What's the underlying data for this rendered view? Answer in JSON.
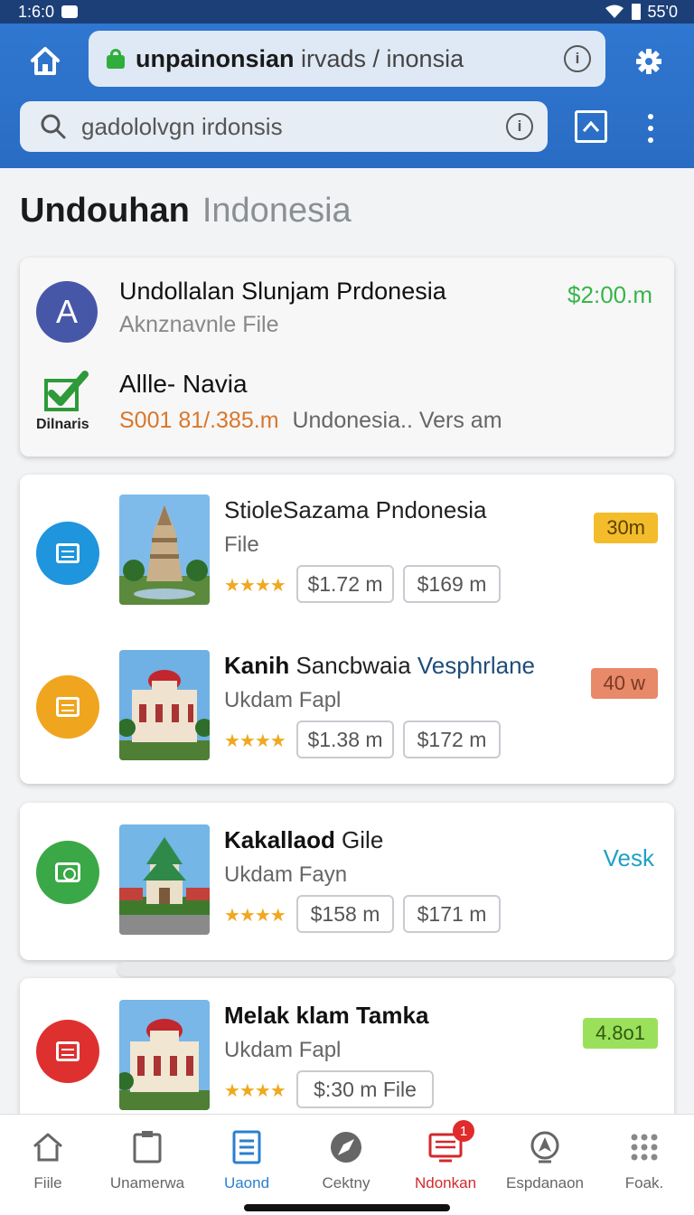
{
  "status_bar": {
    "time": "1:6:0",
    "battery": "55'0"
  },
  "header": {
    "url": {
      "bold": "unpainonsian",
      "rest": " irvads  / inonsia"
    },
    "search": {
      "text": "gadololvgn irdonsis"
    }
  },
  "page_title": {
    "primary": "Undouhan",
    "secondary": "Indonesia"
  },
  "summary": {
    "avatar_letter": "A",
    "title": "Undollalan Slunjam Prdonesia",
    "subtitle": "Aknznavnle File",
    "price": "$2:00.m",
    "check_caption": "Dilnaris",
    "title2": "Allle- Navia",
    "price_line": "S001 81/.385.m",
    "meta_line": "Undonesia..  Vers am"
  },
  "items": [
    {
      "title_bold": "",
      "title_rest": "StioleSazama Pndonesia",
      "title_blue": "",
      "subtitle": "File",
      "stars": "★★★★",
      "price1": "$1.72 m",
      "price2": "$169 m",
      "badge": "30m",
      "badge_bg": "#f3bc2b",
      "badge_fg": "#5a4100",
      "circle_color": "#1e95dc",
      "icon": "document-icon"
    },
    {
      "title_bold": "Kanih",
      "title_rest": " Sancbwaia ",
      "title_blue": "Vesphrlane",
      "subtitle": "Ukdam Fapl",
      "stars": "★★★★",
      "price1": "$1.38 m",
      "price2": "$172 m",
      "badge": "40 w",
      "badge_bg": "#e8896a",
      "badge_fg": "#7a3a22",
      "circle_color": "#f0a51e",
      "icon": "document-icon"
    },
    {
      "title_bold": "Kakallaod",
      "title_rest": " Gile",
      "title_blue": "",
      "subtitle": "Ukdam Fayn",
      "stars": "★★★★",
      "price1": "$158 m",
      "price2": "$171 m",
      "badge": "Vesk",
      "badge_bg": "",
      "badge_fg": "#1fa0c4",
      "circle_color": "#3aa846",
      "icon": "camera-icon"
    },
    {
      "title_bold": "Melak klam Tamka",
      "title_rest": "",
      "title_blue": "",
      "subtitle": "Ukdam Fapl",
      "stars": "★★★★",
      "price1": "$:30 m File",
      "price2": "",
      "badge": "4.8o1",
      "badge_bg": "#9be05a",
      "badge_fg": "#2f5a10",
      "circle_color": "#df3030",
      "icon": "document-icon"
    }
  ],
  "bottom_nav": [
    {
      "label": "Fiile",
      "icon": "home-icon"
    },
    {
      "label": "Unamerwa",
      "icon": "clipboard-icon"
    },
    {
      "label": "Uaond",
      "icon": "document-icon"
    },
    {
      "label": "Cektny",
      "icon": "compass-icon"
    },
    {
      "label": "Ndonkan",
      "icon": "monitor-icon",
      "badge": "1"
    },
    {
      "label": "Espdanaon",
      "icon": "location-icon"
    },
    {
      "label": "Foak.",
      "icon": "grid-icon"
    }
  ]
}
